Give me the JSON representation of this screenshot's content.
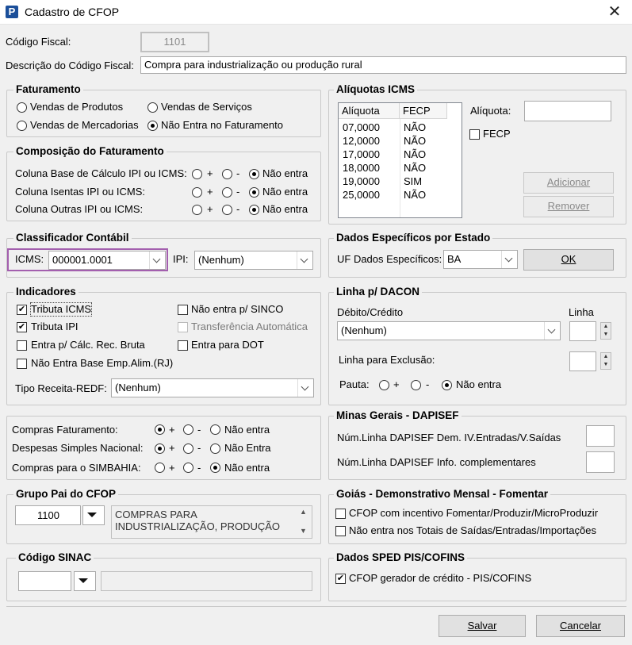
{
  "window": {
    "title": "Cadastro de CFOP",
    "app_icon": "P"
  },
  "header": {
    "codigo_label": "Código Fiscal:",
    "codigo_value": "1101",
    "descricao_label": "Descrição do Código Fiscal:",
    "descricao_value": "Compra para industrialização ou produção rural"
  },
  "faturamento": {
    "title": "Faturamento",
    "options": [
      "Vendas de Produtos",
      "Vendas de Serviços",
      "Vendas de Mercadorias",
      "Não Entra no Faturamento"
    ],
    "selected": "Não Entra no Faturamento"
  },
  "composicao": {
    "title": "Composição do Faturamento",
    "rows": [
      {
        "label": "Coluna Base de Cálculo IPI ou ICMS:"
      },
      {
        "label": "Coluna Isentas IPI ou ICMS:"
      },
      {
        "label": "Coluna Outras IPI ou ICMS:"
      }
    ],
    "opt_plus": "+",
    "opt_minus": "-",
    "opt_none": "Não entra",
    "selected": "Não entra"
  },
  "classificador": {
    "title": "Classificador Contábil",
    "icms_label": "ICMS:",
    "icms_value": "000001.0001",
    "ipi_label": "IPI:",
    "ipi_value": "(Nenhum)"
  },
  "indicadores": {
    "title": "Indicadores",
    "tributa_icms": "Tributa ICMS",
    "tributa_ipi": "Tributa IPI",
    "entra_calc": "Entra p/ Cálc. Rec. Bruta",
    "nao_entra_base": "Não Entra Base Emp.Alim.(RJ)",
    "nao_entra_sinco": "Não entra p/ SINCO",
    "transferencia": "Transferência Automática",
    "entra_dot": "Entra para DOT",
    "tipo_receita_label": "Tipo Receita-REDF:",
    "tipo_receita_value": "(Nenhum)"
  },
  "compras": {
    "rows": [
      {
        "label": "Compras Faturamento:",
        "none": "Não entra"
      },
      {
        "label": "Despesas Simples Nacional:",
        "none": "Não Entra"
      },
      {
        "label": "Compras para o SIMBAHIA:",
        "none": "Não entra"
      }
    ],
    "opt_plus": "+",
    "opt_minus": "-"
  },
  "grupo_pai": {
    "title": "Grupo Pai do CFOP",
    "code": "1100",
    "desc_line1": "COMPRAS PARA",
    "desc_line2": "INDUSTRIALIZAÇÃO, PRODUÇÃO"
  },
  "sinac": {
    "title": "Código SINAC",
    "code": "",
    "desc": ""
  },
  "aliquotas": {
    "title": "Alíquotas ICMS",
    "col_aliquota": "Alíquota",
    "col_fecp": "FECP",
    "rows": [
      {
        "aliquota": "07,0000",
        "fecp": "NÃO"
      },
      {
        "aliquota": "12,0000",
        "fecp": "NÃO"
      },
      {
        "aliquota": "17,0000",
        "fecp": "NÃO"
      },
      {
        "aliquota": "18,0000",
        "fecp": "NÃO"
      },
      {
        "aliquota": "19,0000",
        "fecp": "SIM"
      },
      {
        "aliquota": "25,0000",
        "fecp": "NÃO"
      }
    ],
    "aliquota_label": "Alíquota:",
    "aliquota_value": "",
    "fecp_label": "FECP",
    "adicionar": "Adicionar",
    "remover": "Remover"
  },
  "dados_estado": {
    "title": "Dados Específicos por Estado",
    "uf_label": "UF Dados Específicos:",
    "uf_value": "BA",
    "ok": "OK"
  },
  "dacon": {
    "title": "Linha p/ DACON",
    "debito_label": "Débito/Crédito",
    "linha_label": "Linha",
    "debito_value": "(Nenhum)",
    "exclusao_label": "Linha para Exclusão:",
    "pauta_label": "Pauta:",
    "opt_plus": "+",
    "opt_minus": "-",
    "opt_none": "Não entra"
  },
  "minas": {
    "title": "Minas Gerais - DAPISEF",
    "row1": "Núm.Linha DAPISEF Dem. IV.Entradas/V.Saídas",
    "row2": "Núm.Linha DAPISEF Info. complementares"
  },
  "goias": {
    "title": "Goiás - Demonstrativo Mensal - Fomentar",
    "opt1": "CFOP com incentivo  Fomentar/Produzir/MicroProduzir",
    "opt2": "Não entra nos Totais de  Saídas/Entradas/Importações"
  },
  "sped": {
    "title": "Dados SPED PIS/COFINS",
    "opt1": "CFOP gerador de crédito - PIS/COFINS"
  },
  "footer": {
    "salvar": "Salvar",
    "cancelar": "Cancelar"
  }
}
